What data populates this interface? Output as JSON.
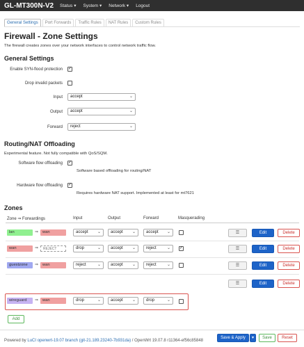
{
  "header": {
    "brand": "GL-MT300N-V2",
    "menu": [
      "Status",
      "System",
      "Network",
      "Logout"
    ]
  },
  "tabs": [
    "General Settings",
    "Port Forwards",
    "Traffic Rules",
    "NAT Rules",
    "Custom Rules"
  ],
  "page": {
    "title": "Firewall - Zone Settings",
    "description": "The firewall creates zones over your network interfaces to control network traffic flow."
  },
  "general": {
    "heading": "General Settings",
    "syn_flood_label": "Enable SYN-flood protection",
    "syn_flood_checked": true,
    "drop_invalid_label": "Drop invalid packets",
    "drop_invalid_checked": false,
    "input_label": "Input",
    "input_value": "accept",
    "output_label": "Output",
    "output_value": "accept",
    "forward_label": "Forward",
    "forward_value": "reject"
  },
  "offload": {
    "heading": "Routing/NAT Offloading",
    "description": "Experimental feature. Not fully compatible with QoS/SQM.",
    "software_label": "Software flow offloading",
    "software_checked": true,
    "software_hint": "Software based offloading for routing/NAT",
    "hardware_label": "Hardware flow offloading",
    "hardware_checked": true,
    "hardware_hint": "Requires hardware NAT support. Implemented at least for mt7621"
  },
  "zones": {
    "heading": "Zones",
    "columns": {
      "zone": "Zone ⇒ Forwardings",
      "input": "Input",
      "output": "Output",
      "forward": "Forward",
      "masquerading": "Masquerading"
    },
    "rows": [
      {
        "zone": "lan",
        "zone_color": "#90f090",
        "target": "wan",
        "target_color": "#f0a0a0",
        "input": "accept",
        "output": "accept",
        "forward": "accept",
        "masq": false
      },
      {
        "zone": "wan",
        "zone_color": "#f0a0a0",
        "target": "REJECT",
        "target_color": "#ffffff",
        "input": "drop",
        "output": "accept",
        "forward": "reject",
        "masq": true
      },
      {
        "zone": "guestzone",
        "zone_color": "#a0a8f0",
        "target": "wan",
        "target_color": "#f0a0a0",
        "input": "reject",
        "output": "accept",
        "forward": "reject",
        "masq": false
      },
      {
        "zone": "wireguard",
        "zone_color": "#c6b3f2",
        "target": "wan",
        "target_color": "#f0a0a0",
        "input": "drop",
        "output": "accept",
        "forward": "drop",
        "masq": false
      }
    ],
    "menu_glyph": "☰",
    "edit_label": "Edit",
    "delete_label": "Delete",
    "add_label": "Add"
  },
  "actions": {
    "save_apply": "Save & Apply",
    "save": "Save",
    "reset": "Reset"
  },
  "footer": {
    "powered": "Powered by ",
    "luci_link": "LuCI openwrt-19.07 branch (git-21.189.23240-7b931da)",
    "version": " / OpenWrt 19.07.8 r11364-ef56c85848"
  },
  "colors": {
    "topbar": "#2f2f2f",
    "primary": "#1d63c8",
    "danger": "#d9534f",
    "success": "#5cb85c"
  }
}
